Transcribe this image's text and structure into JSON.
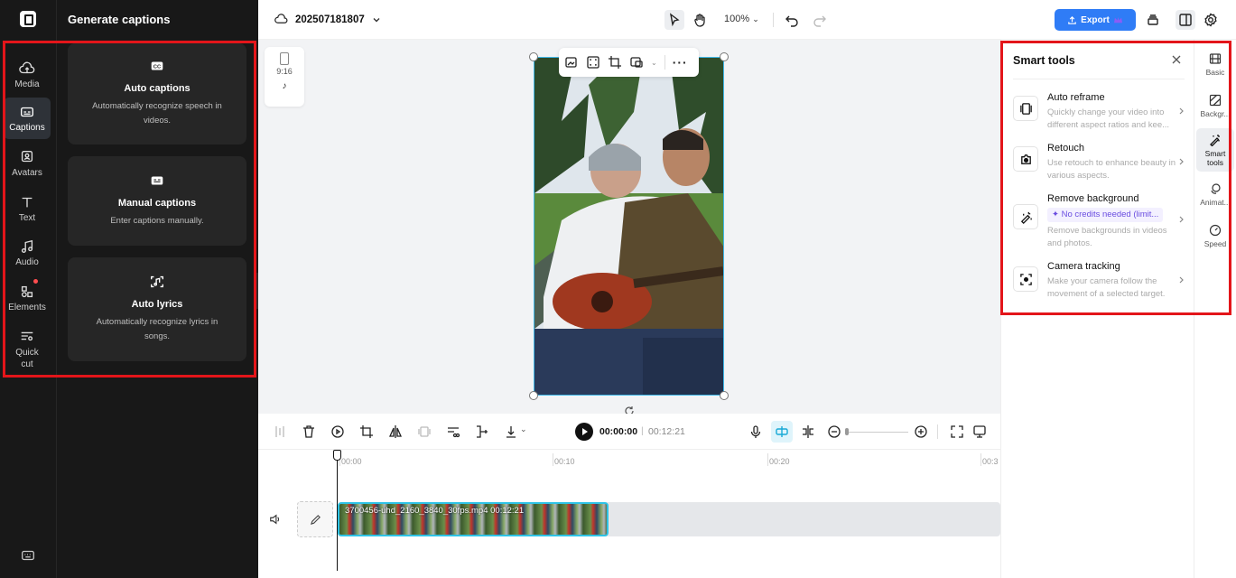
{
  "project": {
    "name": "202507181807"
  },
  "topbar": {
    "zoom": "100%",
    "export_label": "Export"
  },
  "rail": {
    "items": [
      {
        "label": "Media"
      },
      {
        "label": "Captions"
      },
      {
        "label": "Avatars"
      },
      {
        "label": "Text"
      },
      {
        "label": "Audio"
      },
      {
        "label": "Elements"
      },
      {
        "label": "Quick cut"
      }
    ],
    "active": "Captions"
  },
  "captions_panel": {
    "title": "Generate captions",
    "cards": [
      {
        "title": "Auto captions",
        "desc": "Automatically recognize speech in videos."
      },
      {
        "title": "Manual captions",
        "desc": "Enter captions manually."
      },
      {
        "title": "Auto lyrics",
        "desc": "Automatically recognize lyrics in songs."
      }
    ]
  },
  "canvas": {
    "ratio": "9:16"
  },
  "player": {
    "current": "00:00:00",
    "separator": "|",
    "total": "00:12:21"
  },
  "timeline": {
    "ruler": [
      "00:00",
      "00:10",
      "00:20",
      "00:3"
    ],
    "clip_label": "3700456-uhd_2160_3840_30fps.mp4",
    "clip_duration": "00:12:21"
  },
  "smart_tools": {
    "title": "Smart tools",
    "tools": [
      {
        "name": "Auto reframe",
        "desc": "Quickly change your video into different aspect ratios and kee..."
      },
      {
        "name": "Retouch",
        "desc": "Use retouch to enhance beauty in various aspects."
      },
      {
        "name": "Remove background",
        "badge": "✦ No credits needed (limit...",
        "desc": "Remove backgrounds in videos and photos."
      },
      {
        "name": "Camera tracking",
        "desc": "Make your camera follow the movement of a selected target."
      }
    ]
  },
  "right_tabs": [
    {
      "label": "Basic"
    },
    {
      "label": "Backgr..."
    },
    {
      "label": "Smart tools"
    },
    {
      "label": "Animat..."
    },
    {
      "label": "Speed"
    }
  ],
  "colors": {
    "accent": "#2f7cf6",
    "highlight": "#e3151a",
    "selection": "#3fb8e8"
  }
}
